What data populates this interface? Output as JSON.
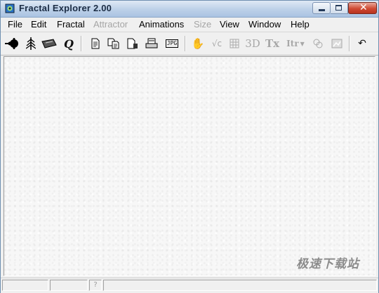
{
  "window": {
    "title": "Fractal Explorer 2.00"
  },
  "menu": [
    {
      "label": "File",
      "enabled": true
    },
    {
      "label": "Edit",
      "enabled": true
    },
    {
      "label": "Fractal",
      "enabled": true
    },
    {
      "label": "Attractor",
      "enabled": false
    },
    {
      "label": "Animations",
      "enabled": true
    },
    {
      "label": "Size",
      "enabled": false
    },
    {
      "label": "View",
      "enabled": true
    },
    {
      "label": "Window",
      "enabled": true
    },
    {
      "label": "Help",
      "enabled": true
    }
  ],
  "toolbar": {
    "jpg_label": "JPG",
    "three_d_label": "3D",
    "tx_label": "Tx",
    "itr_label": "Itr",
    "sqrt_label": "√c",
    "quaternion_label": "Q"
  },
  "status": {
    "help_marker": "?"
  },
  "watermark": "极速下载站",
  "colors": {
    "title_gradient_top": "#dfe9f5",
    "close_button": "#cf4a33",
    "canvas": "#f7f7f7"
  }
}
